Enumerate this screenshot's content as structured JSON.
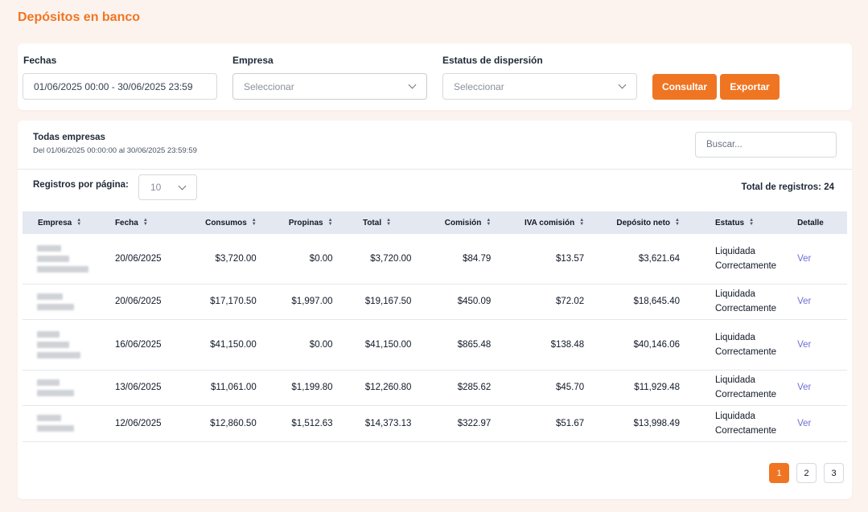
{
  "page": {
    "title": "Depósitos en banco"
  },
  "filters": {
    "fechas_label": "Fechas",
    "fechas_value": "01/06/2025 00:00 - 30/06/2025 23:59",
    "empresa_label": "Empresa",
    "empresa_placeholder": "Seleccionar",
    "estatus_label": "Estatus de dispersión",
    "estatus_placeholder": "Seleccionar",
    "consultar_label": "Consultar",
    "exportar_label": "Exportar"
  },
  "panel": {
    "title": "Todas empresas",
    "subtitle": "Del 01/06/2025 00:00:00 al 30/06/2025 23:59:59",
    "search_placeholder": "Buscar...",
    "rpp_label": "Registros por página:",
    "rpp_value": "10",
    "total_label": "Total de registros:",
    "total_value": "24"
  },
  "table": {
    "headers": [
      "Empresa",
      "Fecha",
      "Consumos",
      "Propinas",
      "Total",
      "Comisión",
      "IVA comisión",
      "Depósito neto",
      "Estatus",
      "Detalle"
    ],
    "rows": [
      {
        "fecha": "20/06/2025",
        "consumos": "$3,720.00",
        "propinas": "$0.00",
        "total": "$3,720.00",
        "comision": "$84.79",
        "iva": "$13.57",
        "neto": "$3,621.64",
        "estatus1": "Liquidada",
        "estatus2": "Correctamente",
        "detalle": "Ver"
      },
      {
        "fecha": "20/06/2025",
        "consumos": "$17,170.50",
        "propinas": "$1,997.00",
        "total": "$19,167.50",
        "comision": "$450.09",
        "iva": "$72.02",
        "neto": "$18,645.40",
        "estatus1": "Liquidada",
        "estatus2": "Correctamente",
        "detalle": "Ver"
      },
      {
        "fecha": "16/06/2025",
        "consumos": "$41,150.00",
        "propinas": "$0.00",
        "total": "$41,150.00",
        "comision": "$865.48",
        "iva": "$138.48",
        "neto": "$40,146.06",
        "estatus1": "Liquidada",
        "estatus2": "Correctamente",
        "detalle": "Ver"
      },
      {
        "fecha": "13/06/2025",
        "consumos": "$11,061.00",
        "propinas": "$1,199.80",
        "total": "$12,260.80",
        "comision": "$285.62",
        "iva": "$45.70",
        "neto": "$11,929.48",
        "estatus1": "Liquidada",
        "estatus2": "Correctamente",
        "detalle": "Ver"
      },
      {
        "fecha": "12/06/2025",
        "consumos": "$12,860.50",
        "propinas": "$1,512.63",
        "total": "$14,373.13",
        "comision": "$322.97",
        "iva": "$51.67",
        "neto": "$13,998.49",
        "estatus1": "Liquidada",
        "estatus2": "Correctamente",
        "detalle": "Ver"
      }
    ]
  },
  "pagination": {
    "pages": [
      "1",
      "2",
      "3"
    ],
    "active": "1"
  },
  "colors": {
    "accent": "#f07522",
    "link": "#6d6fd6",
    "background": "#fdf3ee",
    "header_row": "#e4e8f0"
  }
}
